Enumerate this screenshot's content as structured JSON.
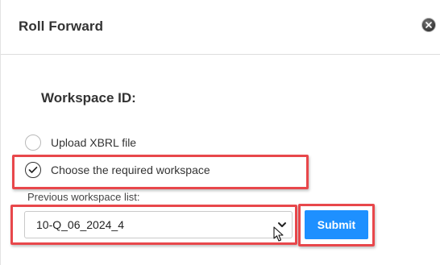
{
  "dialog": {
    "title": "Roll Forward",
    "close_icon": "close-circle-icon"
  },
  "section": {
    "title": "Workspace ID:"
  },
  "options": {
    "upload_label": "Upload XBRL file",
    "choose_label": "Choose the required workspace",
    "selected": "choose"
  },
  "workspace_list": {
    "label": "Previous workspace list:",
    "selected_value": "10-Q_06_2024_4"
  },
  "actions": {
    "submit_label": "Submit"
  },
  "colors": {
    "highlight": "#e8474b",
    "submit_bg": "#1e90ff"
  }
}
